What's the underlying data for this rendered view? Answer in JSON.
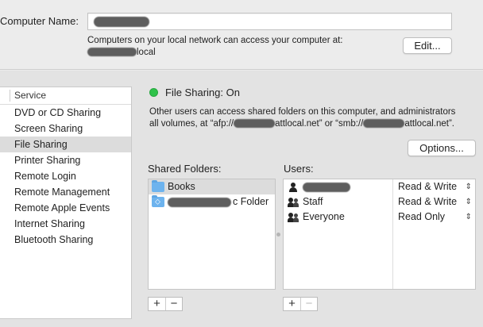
{
  "computer": {
    "name_label": "Computer Name:",
    "info_text": "Computers on your local network can access your computer at:",
    "local_suffix": "local",
    "edit_button": "Edit..."
  },
  "services": {
    "header": "Service",
    "items": [
      {
        "label": "DVD or CD Sharing",
        "selected": false
      },
      {
        "label": "Screen Sharing",
        "selected": false
      },
      {
        "label": "File Sharing",
        "selected": true
      },
      {
        "label": "Printer Sharing",
        "selected": false
      },
      {
        "label": "Remote Login",
        "selected": false
      },
      {
        "label": "Remote Management",
        "selected": false
      },
      {
        "label": "Remote Apple Events",
        "selected": false
      },
      {
        "label": "Internet Sharing",
        "selected": false
      },
      {
        "label": "Bluetooth Sharing",
        "selected": false
      }
    ]
  },
  "status": {
    "text": "File Sharing: On",
    "color": "#2fc24a"
  },
  "description": {
    "line1": "Other users can access shared folders on this computer, and administrators",
    "line2_a": "all volumes, at “afp://",
    "line2_b": "attlocal.net” or “smb://",
    "line2_c": "attlocal.net”."
  },
  "options_button": "Options...",
  "shared_folders": {
    "label": "Shared Folders:",
    "items": [
      {
        "label": "Books",
        "icon": "folder-icon",
        "selected": true
      },
      {
        "label": "c Folder",
        "icon": "public-folder-icon",
        "selected": false
      }
    ]
  },
  "users": {
    "label": "Users:",
    "items": [
      {
        "label": "",
        "icon": "person-icon",
        "permission": "Read & Write"
      },
      {
        "label": "Staff",
        "icon": "group-icon",
        "permission": "Read & Write"
      },
      {
        "label": "Everyone",
        "icon": "everyone-icon",
        "permission": "Read Only"
      }
    ]
  },
  "controls": {
    "add": "+",
    "remove": "−"
  }
}
